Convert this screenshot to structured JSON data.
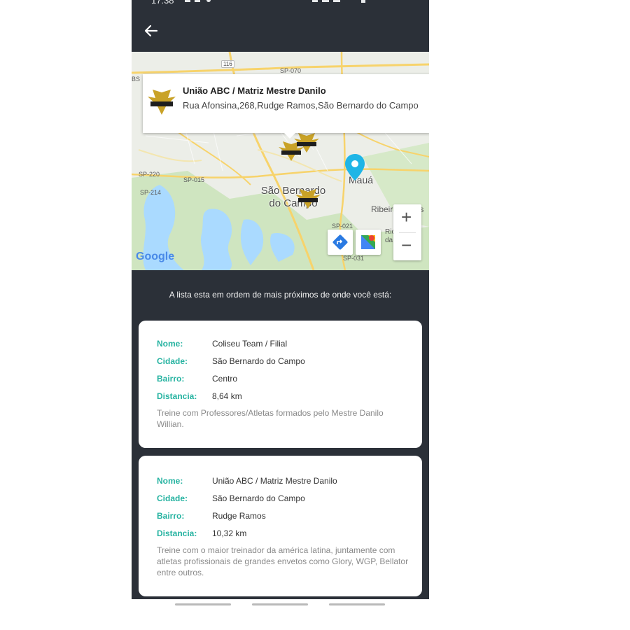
{
  "status_bar": {
    "time": "17:38"
  },
  "app_bar": {
    "back_icon": "arrow-left-icon"
  },
  "map": {
    "info_window": {
      "title": "União ABC / Matriz Mestre Danilo",
      "address": "Rua Afonsina,268,Rudge Ramos,São Bernardo do Campo",
      "logo_text": "UNIÃO ABC"
    },
    "labels": {
      "city_sbc": "São Bernardo do Campo",
      "city_maua": "Mauá",
      "ribeirao": "Ribeirão Pires",
      "rio_grande": "Rio Grande da Serra",
      "sp070": "SP-070",
      "sp015": "SP-015",
      "sp220": "SP-220",
      "sp214": "SP-214",
      "sp021": "SP-021",
      "sp031": "SP-031",
      "br116": "116",
      "bs": "BS"
    },
    "marker_text": "UNIÃO ABC",
    "zoom_in": "+",
    "zoom_out": "−",
    "google_logo": "Google"
  },
  "list_caption": "A lista esta em ordem de mais próximos de onde você está:",
  "field_labels": {
    "nome": "Nome:",
    "cidade": "Cidade:",
    "bairro": "Bairro:",
    "distancia": "Distancia:"
  },
  "cards": [
    {
      "nome": "Coliseu Team / Filial",
      "cidade": "São Bernardo do Campo",
      "bairro": "Centro",
      "distancia": "8,64 km",
      "description": "Treine com Professores/Atletas formados pelo Mestre Danilo Willian."
    },
    {
      "nome": "União ABC / Matriz Mestre Danilo",
      "cidade": "São Bernardo do Campo",
      "bairro": "Rudge Ramos",
      "distancia": "10,32 km",
      "description": "Treine com o maior treinador da américa latina, juntamente com atletas profissionais de grandes envetos como Glory, WGP, Bellator entre outros."
    }
  ],
  "colors": {
    "app_bar": "#2b3038",
    "label_accent": "#26b3a1",
    "pin": "#1fb5e6"
  }
}
